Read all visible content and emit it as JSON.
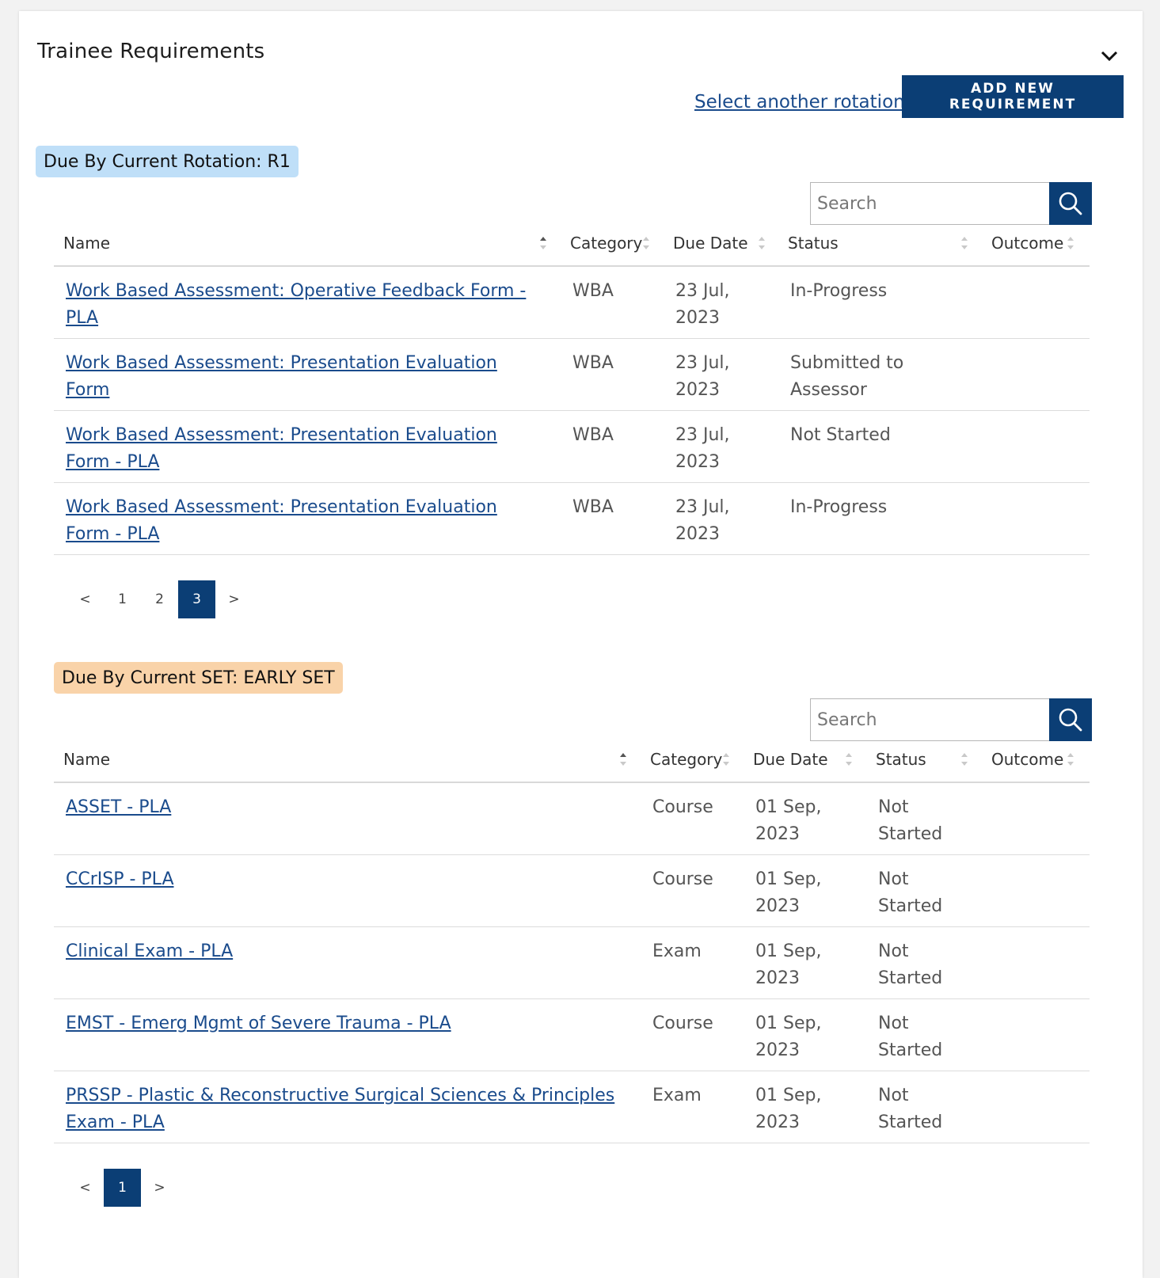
{
  "card": {
    "title": "Trainee Requirements",
    "select_link": "Select another rotation",
    "add_button": "ADD NEW REQUIREMENT"
  },
  "colors": {
    "primary": "#0b3e75",
    "link": "#1a4b8c",
    "rotation_badge": "#bfdff8",
    "set_badge": "#f9d3a9"
  },
  "rotation_section": {
    "badge": "Due By Current Rotation:  R1",
    "search_placeholder": "Search",
    "columns": {
      "name": "Name",
      "category": "Category",
      "due_date": "Due Date",
      "status": "Status",
      "outcome": "Outcome"
    },
    "rows": [
      {
        "name": "Work Based Assessment: Operative Feedback Form - PLA",
        "category": "WBA",
        "due_date_line1": "23 Jul,",
        "due_date_line2": "2023",
        "status": "In-Progress",
        "outcome": ""
      },
      {
        "name": "Work Based Assessment: Presentation Evaluation Form",
        "category": "WBA",
        "due_date_line1": "23 Jul,",
        "due_date_line2": "2023",
        "status": "Submitted to Assessor",
        "outcome": ""
      },
      {
        "name": "Work Based Assessment: Presentation Evaluation Form - PLA",
        "category": "WBA",
        "due_date_line1": "23 Jul,",
        "due_date_line2": "2023",
        "status": "Not Started",
        "outcome": ""
      },
      {
        "name": "Work Based Assessment: Presentation Evaluation Form - PLA",
        "category": "WBA",
        "due_date_line1": "23 Jul,",
        "due_date_line2": "2023",
        "status": "In-Progress",
        "outcome": ""
      }
    ],
    "pagination": {
      "prev": "<",
      "pages": [
        "1",
        "2",
        "3"
      ],
      "current": "3",
      "next": ">"
    }
  },
  "set_section": {
    "badge": "Due By Current SET:  EARLY SET",
    "search_placeholder": "Search",
    "columns": {
      "name": "Name",
      "category": "Category",
      "due_date": "Due Date",
      "status": "Status",
      "outcome": "Outcome"
    },
    "rows": [
      {
        "name": "ASSET - PLA",
        "category": "Course",
        "due_date_line1": "01 Sep,",
        "due_date_line2": "2023",
        "status": "Not Started",
        "outcome": ""
      },
      {
        "name": "CCrISP - PLA",
        "category": "Course",
        "due_date_line1": "01 Sep,",
        "due_date_line2": "2023",
        "status": "Not Started",
        "outcome": ""
      },
      {
        "name": "Clinical Exam - PLA",
        "category": "Exam",
        "due_date_line1": "01 Sep,",
        "due_date_line2": "2023",
        "status": "Not Started",
        "outcome": ""
      },
      {
        "name": "EMST - Emerg Mgmt of Severe Trauma - PLA",
        "category": "Course",
        "due_date_line1": "01 Sep,",
        "due_date_line2": "2023",
        "status": "Not Started",
        "outcome": ""
      },
      {
        "name": "PRSSP - Plastic & Reconstructive Surgical Sciences & Principles Exam - PLA",
        "category": "Exam",
        "due_date_line1": "01 Sep,",
        "due_date_line2": "2023",
        "status": "Not Started",
        "outcome": ""
      }
    ],
    "pagination": {
      "prev": "<",
      "pages": [
        "1"
      ],
      "current": "1",
      "next": ">"
    }
  }
}
